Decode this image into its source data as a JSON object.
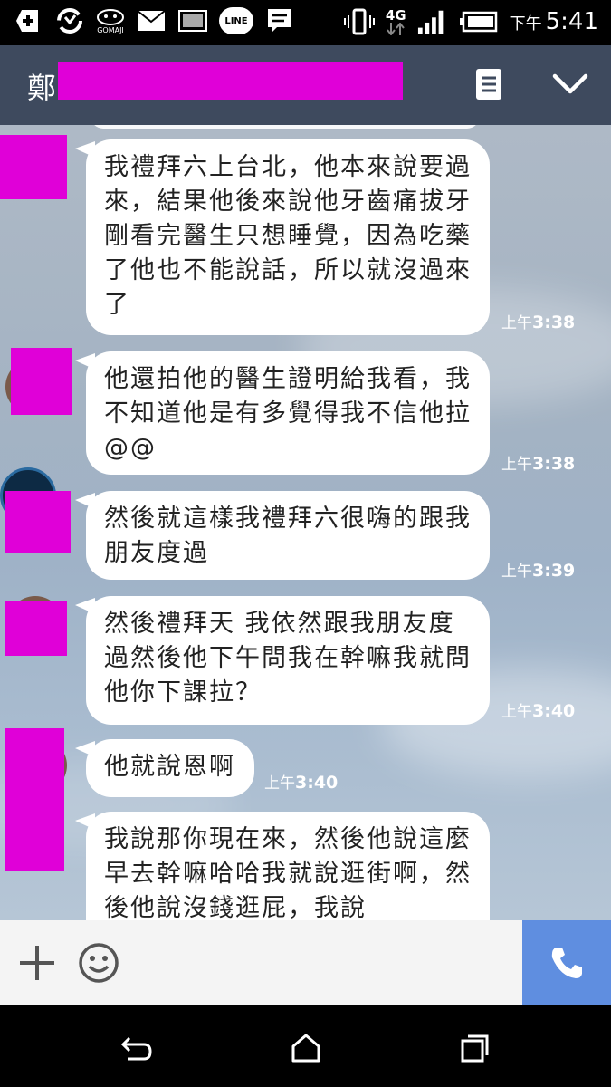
{
  "status_bar": {
    "time_prefix": "下午",
    "time": "5:41",
    "network": "4G",
    "gomaji_label": "GOMAJI",
    "line_label": "LINE"
  },
  "header": {
    "contact_name": "鄭"
  },
  "messages": [
    {
      "text": "我禮拜六上台北，他本來說要過來，結果他後來說他牙齒痛拔牙剛看完醫生只想睡覺，因為吃藥了他也不能說話，所以就沒過來了",
      "time_prefix": "上午",
      "time": "3:38"
    },
    {
      "text": "他還拍他的醫生證明給我看，我不知道他是有多覺得我不信他拉@@",
      "time_prefix": "上午",
      "time": "3:38"
    },
    {
      "text": "然後就這樣我禮拜六很嗨的跟我朋友度過",
      "time_prefix": "上午",
      "time": "3:39"
    },
    {
      "text": "然後禮拜天 我依然跟我朋友度過然後他下午問我在幹嘛我就問他你下課拉？",
      "time_prefix": "上午",
      "time": "3:40"
    },
    {
      "text": "他就說恩啊",
      "time_prefix": "上午",
      "time": "3:40"
    },
    {
      "text": "我說那你現在來，然後他說這麼早去幹嘛哈哈我就說逛街啊，然後他說沒錢逛屁，我說",
      "time_prefix": "",
      "time": ""
    }
  ],
  "colors": {
    "header_bg": "#3e4a5e",
    "call_button": "#5f8ee0",
    "redaction": "#e000d8"
  },
  "icons": {
    "add": "plus-icon",
    "emoji": "smiley-icon",
    "call": "phone-icon",
    "menu": "note-icon",
    "collapse": "chevron-down-icon"
  }
}
